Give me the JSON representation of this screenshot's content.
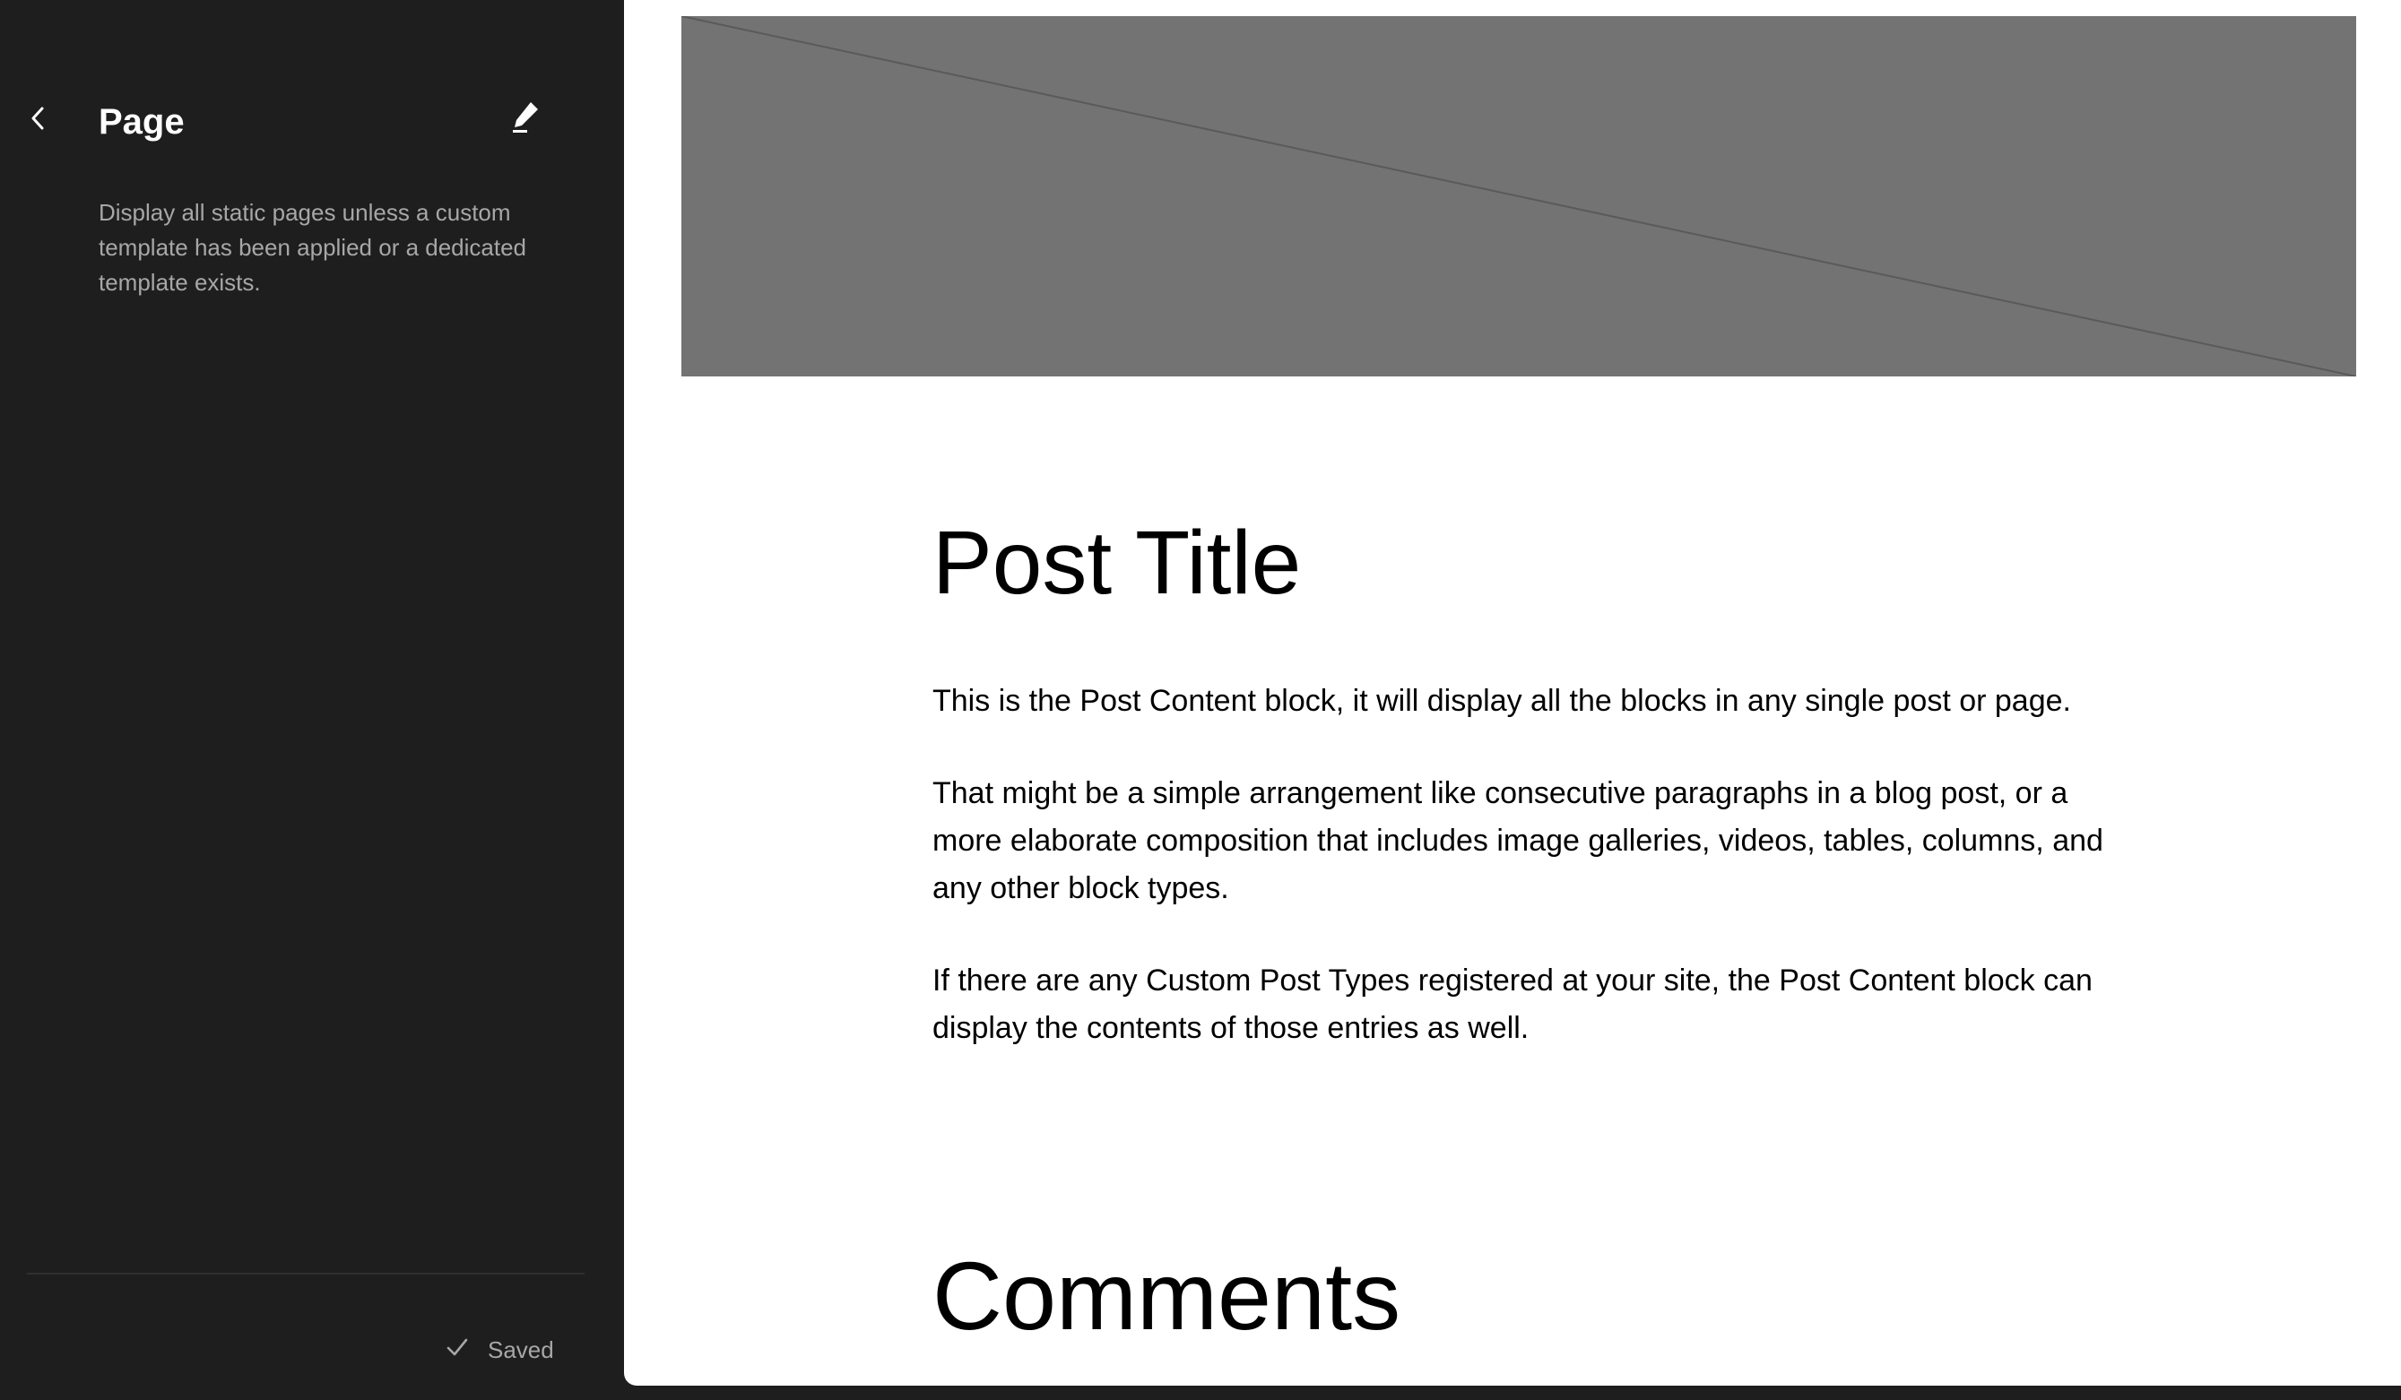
{
  "sidebar": {
    "back_label": "Back",
    "title": "Page",
    "edit_label": "Edit",
    "description": "Display all static pages unless a custom template has been applied or a dedicated template exists.",
    "save_status": "Saved"
  },
  "canvas": {
    "featured_image_placeholder": "Featured image",
    "post_title": "Post Title",
    "paragraphs": [
      "This is the Post Content block, it will display all the blocks in any single post or page.",
      "That might be a simple arrangement like consecutive paragraphs in a blog post, or a more elaborate composition that includes image galleries, videos, tables, columns, and any other block types.",
      "If there are any Custom Post Types registered at your site, the Post Content block can display the contents of those entries as well."
    ],
    "comments_title": "Comments"
  },
  "icons": {
    "back": "chevron-left-icon",
    "edit": "pencil-icon",
    "saved": "check-icon"
  },
  "colors": {
    "sidebar_bg": "#1e1e1e",
    "canvas_bg": "#ffffff",
    "placeholder_bg": "#737373",
    "muted_text": "#a7a7a7"
  }
}
